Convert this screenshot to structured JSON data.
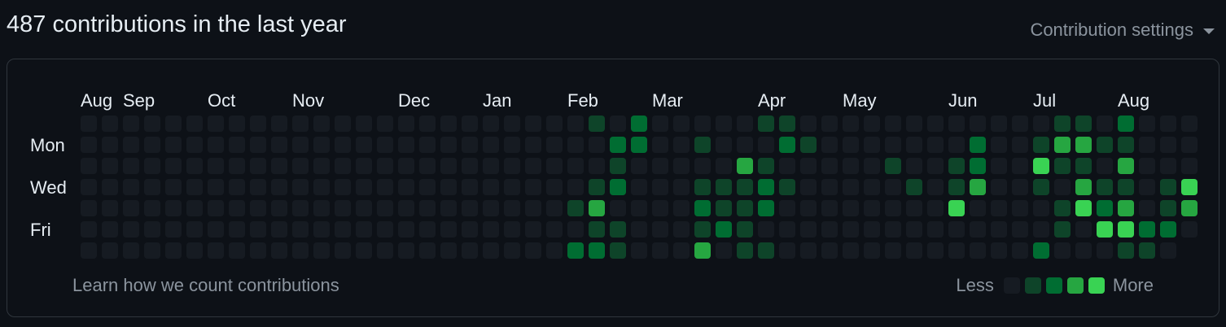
{
  "header": {
    "title": "487 contributions in the last year",
    "settings_label": "Contribution settings"
  },
  "calendar": {
    "months": [
      "Aug",
      "Sep",
      "Oct",
      "Nov",
      "Dec",
      "Jan",
      "Feb",
      "Mar",
      "Apr",
      "May",
      "Jun",
      "Jul",
      "Aug"
    ],
    "month_start_weeks": [
      0,
      2,
      6,
      10,
      15,
      19,
      23,
      27,
      32,
      36,
      41,
      45,
      49
    ],
    "day_labels": [
      {
        "row": 1,
        "label": "Mon"
      },
      {
        "row": 3,
        "label": "Wed"
      },
      {
        "row": 5,
        "label": "Fri"
      }
    ],
    "level_colors": [
      "#161b22",
      "#0e4429",
      "#006d32",
      "#26a641",
      "#39d353"
    ],
    "active_cells": [
      [
        23,
        4,
        1
      ],
      [
        23,
        6,
        2
      ],
      [
        24,
        0,
        1
      ],
      [
        24,
        3,
        1
      ],
      [
        24,
        4,
        3
      ],
      [
        24,
        5,
        1
      ],
      [
        24,
        6,
        2
      ],
      [
        25,
        1,
        2
      ],
      [
        25,
        2,
        1
      ],
      [
        25,
        3,
        2
      ],
      [
        25,
        5,
        1
      ],
      [
        25,
        6,
        1
      ],
      [
        26,
        0,
        2
      ],
      [
        26,
        1,
        2
      ],
      [
        29,
        1,
        1
      ],
      [
        29,
        3,
        1
      ],
      [
        29,
        4,
        2
      ],
      [
        29,
        5,
        1
      ],
      [
        29,
        6,
        3
      ],
      [
        30,
        3,
        1
      ],
      [
        30,
        4,
        1
      ],
      [
        30,
        5,
        2
      ],
      [
        31,
        2,
        3
      ],
      [
        31,
        3,
        1
      ],
      [
        31,
        4,
        1
      ],
      [
        31,
        5,
        1
      ],
      [
        31,
        6,
        1
      ],
      [
        32,
        0,
        1
      ],
      [
        32,
        2,
        1
      ],
      [
        32,
        3,
        2
      ],
      [
        32,
        4,
        2
      ],
      [
        32,
        6,
        1
      ],
      [
        33,
        0,
        1
      ],
      [
        33,
        1,
        2
      ],
      [
        33,
        3,
        1
      ],
      [
        34,
        1,
        1
      ],
      [
        38,
        2,
        1
      ],
      [
        39,
        3,
        1
      ],
      [
        41,
        2,
        1
      ],
      [
        41,
        3,
        1
      ],
      [
        41,
        4,
        4
      ],
      [
        42,
        1,
        2
      ],
      [
        42,
        2,
        2
      ],
      [
        42,
        3,
        3
      ],
      [
        45,
        1,
        1
      ],
      [
        45,
        2,
        4
      ],
      [
        45,
        3,
        1
      ],
      [
        45,
        6,
        2
      ],
      [
        46,
        0,
        1
      ],
      [
        46,
        1,
        3
      ],
      [
        46,
        2,
        1
      ],
      [
        46,
        4,
        1
      ],
      [
        46,
        5,
        1
      ],
      [
        47,
        0,
        1
      ],
      [
        47,
        1,
        3
      ],
      [
        47,
        2,
        1
      ],
      [
        47,
        3,
        3
      ],
      [
        47,
        4,
        4
      ],
      [
        48,
        1,
        1
      ],
      [
        48,
        3,
        1
      ],
      [
        48,
        4,
        2
      ],
      [
        48,
        5,
        4
      ],
      [
        49,
        0,
        2
      ],
      [
        49,
        1,
        1
      ],
      [
        49,
        2,
        3
      ],
      [
        49,
        3,
        1
      ],
      [
        49,
        4,
        3
      ],
      [
        49,
        5,
        4
      ],
      [
        49,
        6,
        1
      ],
      [
        50,
        5,
        2
      ],
      [
        50,
        6,
        1
      ],
      [
        51,
        3,
        1
      ],
      [
        51,
        4,
        1
      ],
      [
        51,
        5,
        2
      ],
      [
        52,
        3,
        4
      ],
      [
        52,
        4,
        3
      ],
      [
        53,
        2,
        3
      ],
      [
        53,
        3,
        2
      ],
      [
        53,
        4,
        3
      ]
    ]
  },
  "footer": {
    "learn_label": "Learn how we count contributions",
    "less_label": "Less",
    "more_label": "More"
  }
}
